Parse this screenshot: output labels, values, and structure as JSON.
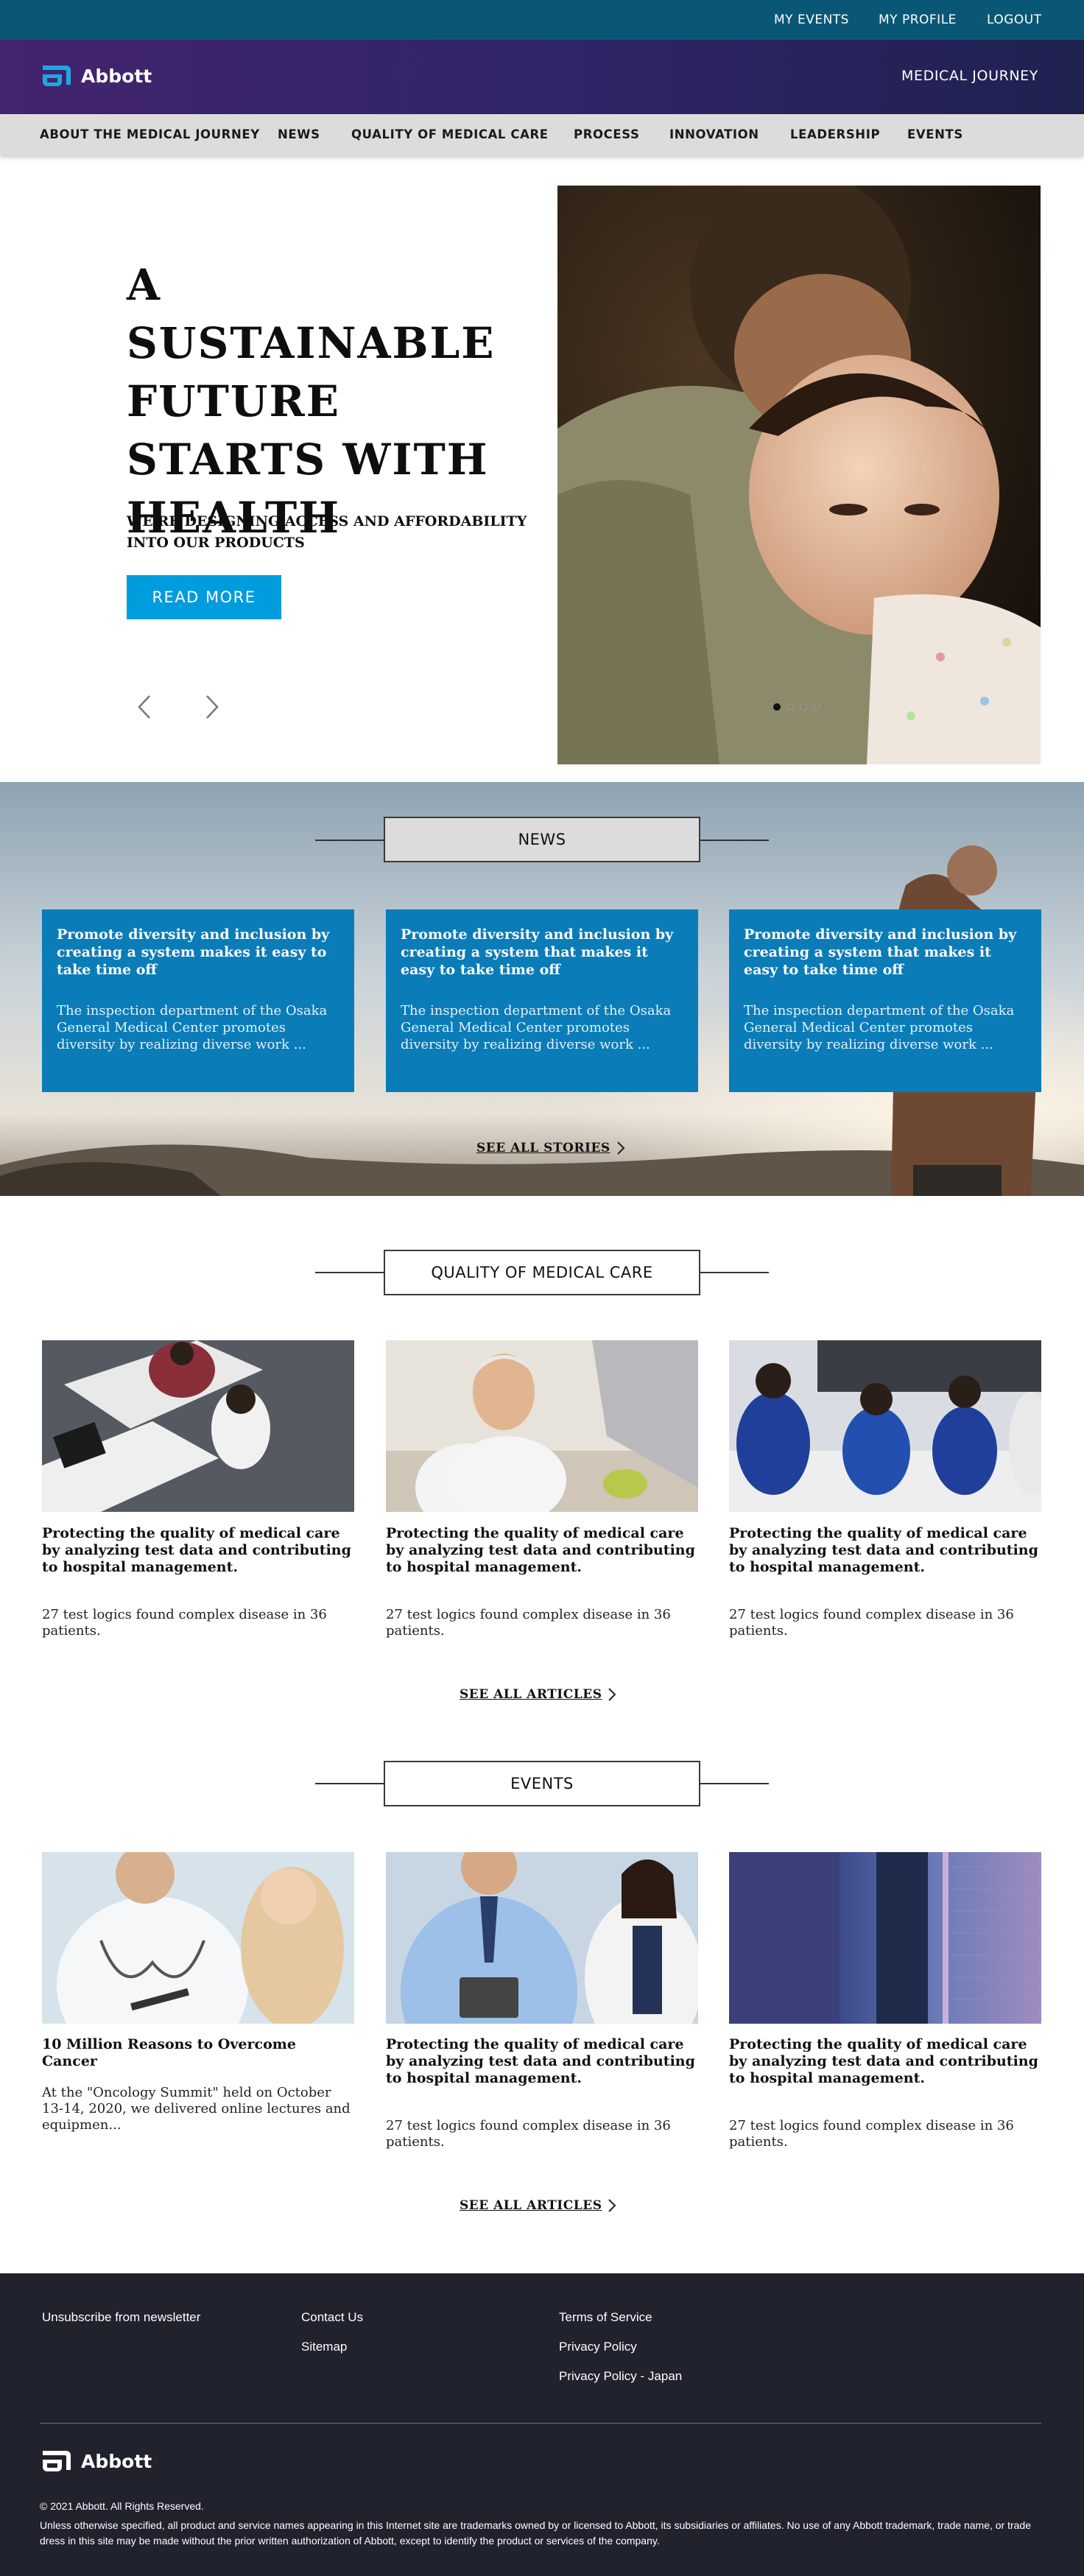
{
  "utility_nav": {
    "my_events": "MY EVENTS",
    "my_profile": "MY PROFILE",
    "logout": "LOGOUT"
  },
  "header": {
    "logo_text": "Abbott",
    "section_title": "MEDICAL JOURNEY"
  },
  "main_nav": [
    {
      "label": "ABOUT THE MEDICAL JOURNEY"
    },
    {
      "label": "NEWS"
    },
    {
      "label": "QUALITY OF MEDICAL CARE"
    },
    {
      "label": "PROCESS"
    },
    {
      "label": "INNOVATION"
    },
    {
      "label": "LEADERSHIP"
    },
    {
      "label": "EVENTS"
    }
  ],
  "hero": {
    "title": "A SUSTAINABLE FUTURE STARTS WITH HEALTH",
    "subtitle": "WE'RE DESIGNING ACCESS AND AFFORDABILITY INTO OUR PRODUCTS",
    "button_label": "READ MORE",
    "prev_icon": "chevron-left-icon",
    "next_icon": "chevron-right-icon",
    "slides_total": 4,
    "active_slide": 1
  },
  "news": {
    "heading": "NEWS",
    "cards": [
      {
        "title": "Promote diversity and inclusion by creating a system makes it easy to take time off",
        "body": "The inspection department of the Osaka General Medical Center promotes diversity by realizing diverse work ..."
      },
      {
        "title": "Promote diversity and inclusion by creating a system that makes it easy to take time off",
        "body": "The inspection department of the Osaka General Medical Center promotes diversity by realizing diverse work ..."
      },
      {
        "title": "Promote diversity and inclusion by creating a system that makes it easy to take time off",
        "body": "The inspection department of the Osaka General Medical Center promotes diversity by realizing diverse work ..."
      }
    ],
    "see_all": "SEE ALL STORIES"
  },
  "quality": {
    "heading": "QUALITY OF MEDICAL CARE",
    "cards": [
      {
        "title": "Protecting the quality of medical care by analyzing test data and contributing to hospital management.",
        "body": "27 test logics found complex disease in 36 patients."
      },
      {
        "title": "Protecting the quality of medical care by analyzing test data and contributing to hospital management.",
        "body": "27 test logics found complex disease in 36 patients."
      },
      {
        "title": "Protecting the quality of medical care by analyzing test data and contributing to hospital management.",
        "body": "27 test logics found complex disease in 36 patients."
      }
    ],
    "see_all": "SEE ALL ARTICLES"
  },
  "events": {
    "heading": "EVENTS",
    "cards": [
      {
        "title": "10 Million Reasons to Overcome Cancer",
        "body": "At the \"Oncology Summit\" held on October 13-14, 2020, we delivered online lectures and equipmen..."
      },
      {
        "title": "Protecting the quality of medical care by analyzing test data and contributing to hospital management.",
        "body": "27 test logics found complex disease in 36 patients."
      },
      {
        "title": "Protecting the quality of medical care by analyzing test data and contributing to hospital management.",
        "body": "27 test logics found complex disease in 36 patients."
      }
    ],
    "see_all": "SEE ALL ARTICLES"
  },
  "footer": {
    "unsubscribe": "Unsubscribe from newsletter",
    "contact": "Contact Us",
    "sitemap": "Sitemap",
    "terms": "Terms of Service",
    "privacy": "Privacy Policy",
    "privacy_japan": "Privacy Policy - Japan",
    "logo_text": "Abbott",
    "copyright": "© 2021 Abbott. All Rights Reserved.",
    "legal": "Unless otherwise specified, all product and service names appearing in this Internet site are trademarks owned by or licensed to Abbott, its subsidiaries or affiliates. No use of any Abbott trademark, trade name, or trade dress in this site may be made without the prior written authorization of Abbott, except to identify the product or services of the company."
  },
  "colors": {
    "utility_bar": "#0a5775",
    "brand_gradient_start": "#43246f",
    "brand_gradient_end": "#1f2150",
    "accent_blue": "#009cde",
    "news_card": "#0a7cb8",
    "footer_bg": "#20222d"
  }
}
